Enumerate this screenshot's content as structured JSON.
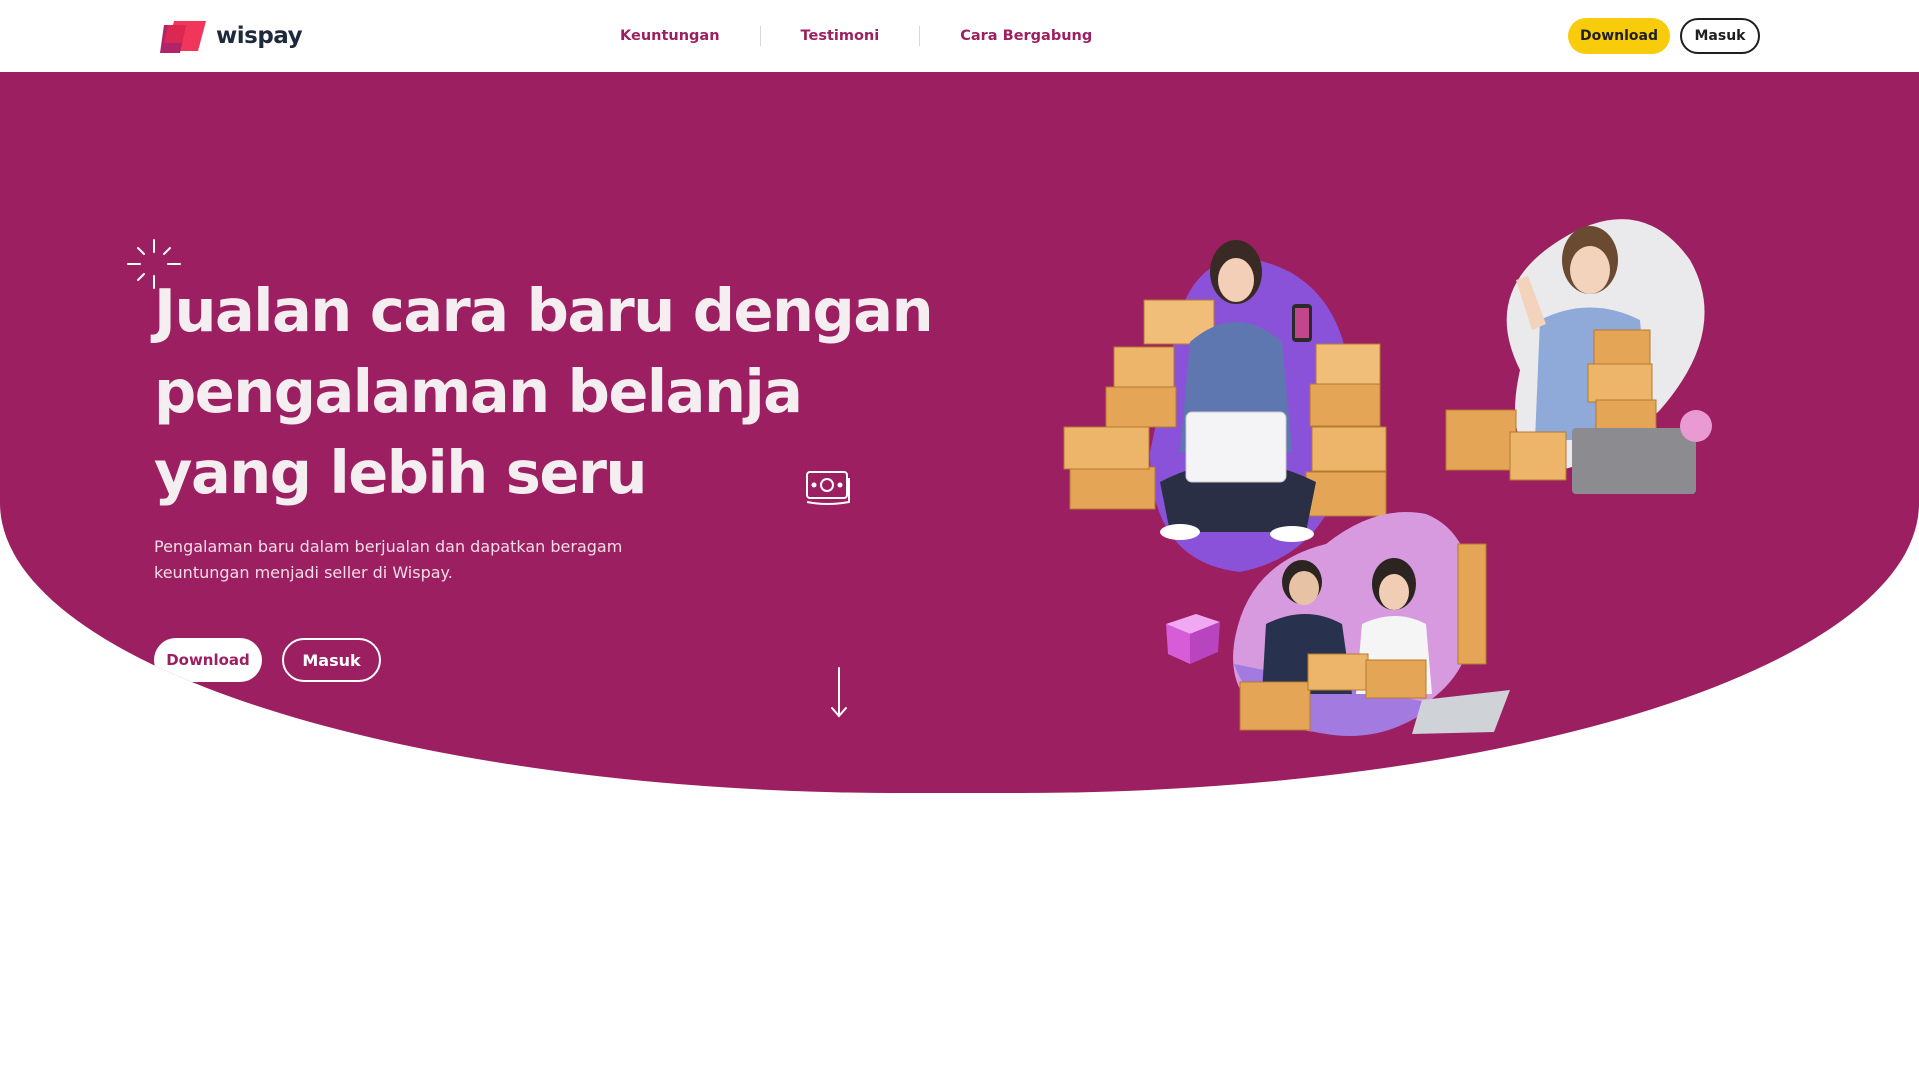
{
  "brand": {
    "name": "wispay",
    "primary_color": "#9c1f61",
    "accent_color": "#f9cc0b",
    "logo_icon": "wispay-logo-icon"
  },
  "nav": {
    "items": [
      {
        "label": "Keuntungan"
      },
      {
        "label": "Testimoni"
      },
      {
        "label": "Cara Bergabung"
      }
    ],
    "download_label": "Download",
    "login_label": "Masuk"
  },
  "hero": {
    "title": "Jualan cara baru dengan pengalaman belanja yang lebih seru",
    "subtitle": "Pengalaman baru dalam berjualan dan dapatkan beragam keuntungan menjadi seller di Wispay.",
    "download_label": "Download",
    "login_label": "Masuk",
    "icons": [
      "sparkle-icon",
      "money-icon",
      "arrow-down-icon"
    ],
    "images": [
      "seller-laptop-boxes-photo",
      "seller-cheering-boxes-photo",
      "couple-packing-boxes-photo",
      "package-3d-icon"
    ]
  }
}
